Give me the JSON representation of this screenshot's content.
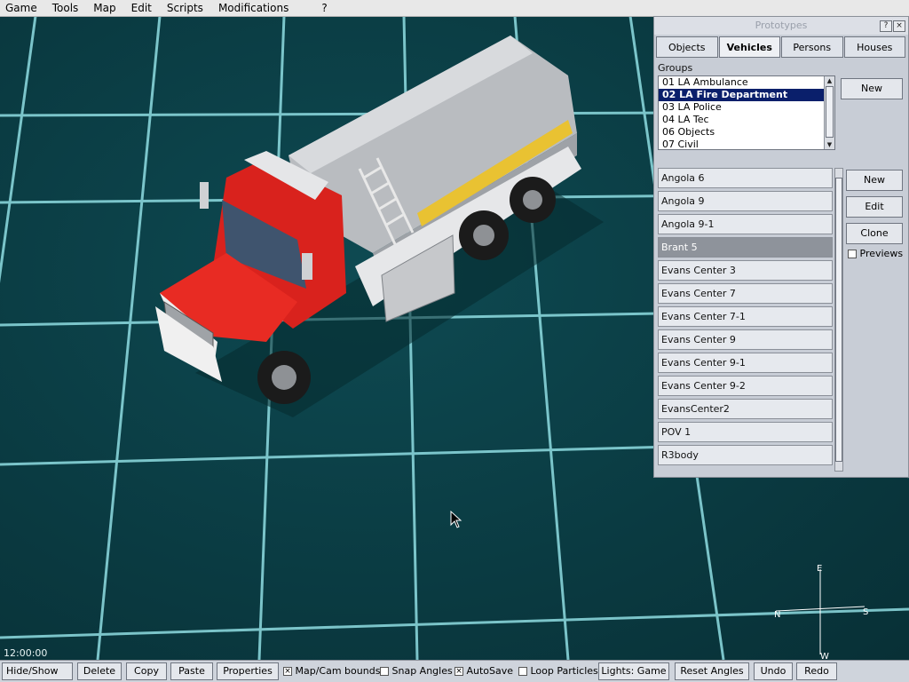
{
  "menubar": {
    "items": [
      "Game",
      "Tools",
      "Map",
      "Edit",
      "Scripts",
      "Modifications",
      "?"
    ]
  },
  "prototypes": {
    "title": "Prototypes",
    "help_label": "?",
    "close_label": "×",
    "tabs": [
      {
        "label": "Objects",
        "active": false
      },
      {
        "label": "Vehicles",
        "active": true
      },
      {
        "label": "Persons",
        "active": false
      },
      {
        "label": "Houses",
        "active": false
      }
    ],
    "groups_label": "Groups",
    "groups": [
      "01 LA Ambulance",
      "02 LA Fire Department",
      "03 LA Police",
      "04 LA Tec",
      "06 Objects",
      "07 Civil"
    ],
    "selected_group": "02 LA Fire Department",
    "groups_new_label": "New",
    "vehicles": [
      "Angola 6",
      "Angola 9",
      "Angola 9-1",
      "Brant 5",
      "Evans Center 3",
      "Evans Center 7",
      "Evans Center 7-1",
      "Evans Center 9",
      "Evans Center 9-1",
      "Evans Center 9-2",
      "EvansCenter2",
      "POV 1",
      "R3body"
    ],
    "selected_vehicle": "Brant 5",
    "new_label": "New",
    "edit_label": "Edit",
    "clone_label": "Clone",
    "previews_label": "Previews",
    "previews_checked": false
  },
  "viewport": {
    "clock": "12:00:00"
  },
  "compass": {
    "north": "N",
    "east": "E",
    "south": "S",
    "west": "W"
  },
  "statusbar": {
    "hide_show": "Hide/Show",
    "delete": "Delete",
    "copy": "Copy",
    "paste": "Paste",
    "properties": "Properties",
    "map_cam_bounds": "Map/Cam bounds",
    "map_cam_bounds_checked": true,
    "snap_angles": "Snap Angles",
    "snap_angles_checked": false,
    "autosave": "AutoSave",
    "autosave_checked": true,
    "loop_particles": "Loop Particles",
    "loop_particles_checked": false,
    "lights": "Lights: Game",
    "reset_angles": "Reset Angles",
    "undo": "Undo",
    "redo": "Redo"
  },
  "colors": {
    "grid_line": "#9fe6ea",
    "background": "#0b3a40",
    "selection": "#0a1f6b",
    "truck_cab": "#d9221d",
    "truck_tank": "#b9bcc0"
  }
}
